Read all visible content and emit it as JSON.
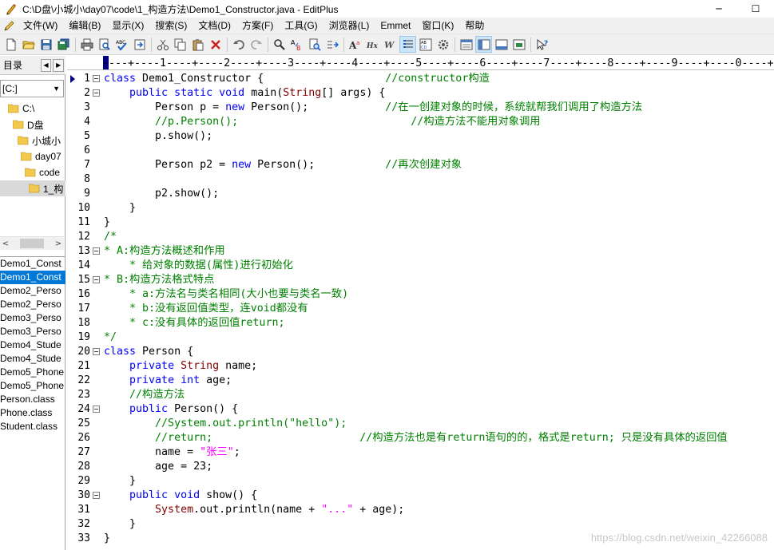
{
  "window": {
    "title": "C:\\D盘\\小城小\\day07\\code\\1_构造方法\\Demo1_Constructor.java - EditPlus",
    "minimize": "─",
    "maximize": "☐"
  },
  "menu": [
    "文件(W)",
    "编辑(B)",
    "显示(X)",
    "搜索(S)",
    "文档(D)",
    "方案(F)",
    "工具(G)",
    "浏览器(L)",
    "Emmet",
    "窗口(K)",
    "帮助"
  ],
  "toolbar_icons": [
    "new-file-icon",
    "open-folder-icon",
    "save-icon",
    "save-all-icon",
    "print-icon",
    "print-preview-icon",
    "spellcheck-icon",
    "browser-icon",
    "cut-icon",
    "copy-icon",
    "paste-icon",
    "delete-icon",
    "undo-icon",
    "redo-icon",
    "find-icon",
    "replace-icon",
    "find-in-files-icon",
    "goto-line-icon",
    "font-icon",
    "hex-icon",
    "word-wrap-icon",
    "line-number-icon",
    "column-select-icon",
    "preferences-icon",
    "directory-window-icon",
    "cliptext-icon",
    "output-window-icon",
    "fullscreen-icon",
    "help-icon"
  ],
  "sidebar": {
    "tab_label": "目录",
    "drive": "[C:]",
    "folders": [
      "C:\\",
      "D盘",
      "小城小",
      "day07",
      "code",
      "1_构"
    ],
    "files": [
      "Demo1_Const",
      "Demo1_Const",
      "Demo2_Perso",
      "Demo2_Perso",
      "Demo3_Perso",
      "Demo3_Perso",
      "Demo4_Stude",
      "Demo4_Stude",
      "Demo5_Phone",
      "Demo5_Phone",
      "Person.class",
      "Phone.class",
      "Student.class"
    ]
  },
  "editor": {
    "ruler": "----+----1----+----2----+----3----+----4----+----5----+----6----+----7----+----8----+----9----+----0----+",
    "watermark": "https://blog.csdn.net/weixin_42266088",
    "lines": [
      {
        "n": "1",
        "text": "class Demo1_Constructor {                   //constructor构造"
      },
      {
        "n": "2",
        "text": "    public static void main(String[] args) {"
      },
      {
        "n": "3",
        "text": "        Person p = new Person();            //在一创建对象的时候，系统就帮我们调用了构造方法"
      },
      {
        "n": "4",
        "text": "        //p.Person();                           //构造方法不能用对象调用"
      },
      {
        "n": "5",
        "text": "        p.show();"
      },
      {
        "n": "6",
        "text": ""
      },
      {
        "n": "7",
        "text": "        Person p2 = new Person();           //再次创建对象"
      },
      {
        "n": "8",
        "text": ""
      },
      {
        "n": "9",
        "text": "        p2.show();"
      },
      {
        "n": "10",
        "text": "    }"
      },
      {
        "n": "11",
        "text": "}"
      },
      {
        "n": "12",
        "text": "/*"
      },
      {
        "n": "13",
        "text": "* A:构造方法概述和作用"
      },
      {
        "n": "14",
        "text": "    * 给对象的数据(属性)进行初始化"
      },
      {
        "n": "15",
        "text": "* B:构造方法格式特点"
      },
      {
        "n": "16",
        "text": "    * a:方法名与类名相同(大小也要与类名一致)"
      },
      {
        "n": "17",
        "text": "    * b:没有返回值类型，连void都没有"
      },
      {
        "n": "18",
        "text": "    * c:没有具体的返回值return;"
      },
      {
        "n": "19",
        "text": "*/"
      },
      {
        "n": "20",
        "text": "class Person {"
      },
      {
        "n": "21",
        "text": "    private String name;"
      },
      {
        "n": "22",
        "text": "    private int age;"
      },
      {
        "n": "23",
        "text": "    //构造方法"
      },
      {
        "n": "24",
        "text": "    public Person() {"
      },
      {
        "n": "25",
        "text": "        //System.out.println(\"hello\");"
      },
      {
        "n": "26",
        "text": "        //return;                       //构造方法也是有return语句的的，格式是return; 只是没有具体的返回值"
      },
      {
        "n": "27",
        "text": "        name = \"张三\";"
      },
      {
        "n": "28",
        "text": "        age = 23;"
      },
      {
        "n": "29",
        "text": "    }"
      },
      {
        "n": "30",
        "text": "    public void show() {"
      },
      {
        "n": "31",
        "text": "        System.out.println(name + \"...\" + age);"
      },
      {
        "n": "32",
        "text": "    }"
      },
      {
        "n": "33",
        "text": "}"
      }
    ]
  },
  "colors": {
    "keyword": "#0000ff",
    "type": "#800000",
    "comment": "#008000",
    "string": "#ff00ff",
    "selection": "#0078d7"
  }
}
